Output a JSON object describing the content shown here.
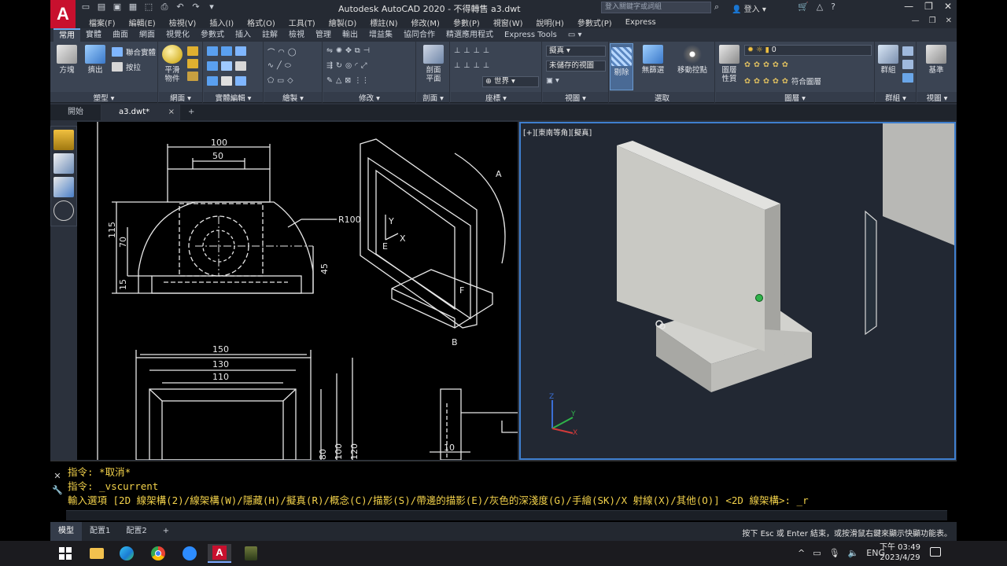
{
  "window": {
    "logo": "A",
    "title": "Autodesk AutoCAD 2020 - 不得轉售    a3.dwt",
    "search_placeholder": "登入關鍵字或詞組",
    "login": "登入",
    "help": "?"
  },
  "menu": [
    "檔案(F)",
    "編輯(E)",
    "檢視(V)",
    "插入(I)",
    "格式(O)",
    "工具(T)",
    "繪製(D)",
    "標註(N)",
    "修改(M)",
    "參數(P)",
    "視窗(W)",
    "說明(H)",
    "參數式(P)",
    "Express"
  ],
  "ribbon_tabs": [
    "常用",
    "實體",
    "曲面",
    "網面",
    "視覺化",
    "參數式",
    "插入",
    "註解",
    "檢視",
    "管理",
    "輸出",
    "增益集",
    "協同合作",
    "精選應用程式",
    "Express Tools"
  ],
  "active_ribbon_tab": "常用",
  "ribbon": {
    "modeling": {
      "title": "塑型",
      "box": "方塊",
      "extrude": "擠出",
      "smooth": "平滑\n物件",
      "union": "聯合實體",
      "presspull": "按拉"
    },
    "mesh": {
      "title": "網面"
    },
    "solid_edit": {
      "title": "實體編輯"
    },
    "draw": {
      "title": "繪製"
    },
    "modify": {
      "title": "修改"
    },
    "section": {
      "title": "剖面",
      "plane": "剖面\n平面"
    },
    "coordinates": {
      "title": "座標",
      "world": "世界"
    },
    "view": {
      "title": "視圖",
      "visual_style": "擬真",
      "saved_view": "未儲存的視圖"
    },
    "selection": {
      "title": "選取",
      "culling": "剔除",
      "no_filter": "無篩選",
      "gizmo": "移動控點"
    },
    "layers": {
      "title": "圖層",
      "layer_props": "圖層\n性質",
      "current_layer": "0",
      "match_layer": "符合圖層"
    },
    "groups": {
      "title": "群組",
      "group": "群組"
    },
    "view2": {
      "title": "視圖",
      "base": "基準"
    }
  },
  "file_tabs": {
    "start": "開始",
    "current": "a3.dwt*",
    "close": "×",
    "add": "+"
  },
  "viewport": {
    "label": "[+][東南等角][擬真]"
  },
  "drawing_labels": {
    "top_dims": [
      "100",
      "50"
    ],
    "radius": "R100",
    "left_dims": [
      "115",
      "70",
      "15"
    ],
    "right_dim": "45",
    "bottom_dims": [
      "150",
      "130",
      "110"
    ],
    "bottom_vert": [
      "80",
      "100",
      "120"
    ],
    "small_dim": "10",
    "points": [
      "A",
      "E",
      "F",
      "B",
      "Y",
      "X"
    ]
  },
  "command": {
    "line1": "指令: *取消*",
    "line2": "指令: _vscurrent",
    "line3": "輸入選項 [2D 線架構(2)/線架構(W)/隱藏(H)/擬真(R)/概念(C)/描影(S)/帶邊的描影(E)/灰色的深淺度(G)/手繪(SK)/X 射線(X)/其他(O)] <2D 線架構>: _r"
  },
  "status": {
    "tabs": [
      "模型",
      "配置1",
      "配置2",
      "+"
    ],
    "message": "按下 Esc 或 Enter 結束，或按滑鼠右鍵來顯示快顯功能表。"
  },
  "taskbar": {
    "lang": "ENG",
    "time": "下午 03:49",
    "date": "2023/4/29"
  },
  "colors": {
    "accent": "#3f7fcf",
    "command_text": "#f2d14a",
    "logo_red": "#c8102e",
    "model_face": "#c9c9c4"
  }
}
